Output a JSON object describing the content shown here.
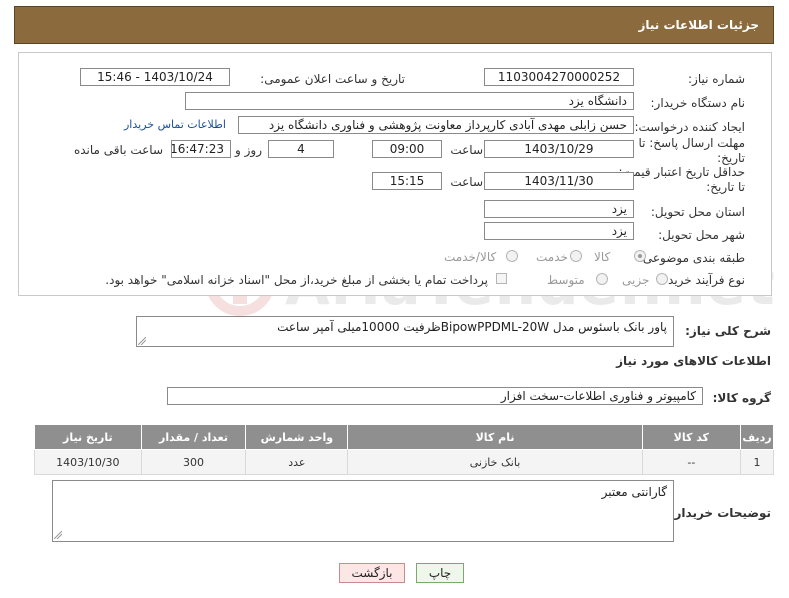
{
  "header": {
    "title": "جزئیات اطلاعات نیاز"
  },
  "form": {
    "need_number_label": "شماره نیاز:",
    "need_number": "1103004270000252",
    "announce_label": "تاریخ و ساعت اعلان عمومی:",
    "announce_value": "1403/10/24 - 15:46",
    "buyer_label": "نام دستگاه خریدار:",
    "buyer_value": "دانشگاه یزد",
    "creator_label": "ایجاد کننده درخواست:",
    "creator_value": "حسن زابلی مهدی آبادی کارپرداز معاونت پژوهشی و فناوری دانشگاه یزد",
    "contact_link": "اطلاعات تماس خریدار",
    "reply_label": "مهلت ارسال پاسخ: تا تاریخ:",
    "reply_date": "1403/10/29",
    "time_label": "ساعت",
    "reply_time": "09:00",
    "days_value": "4",
    "days_label": "روز و",
    "remaining_value": "16:47:23",
    "remaining_label": "ساعت باقی مانده",
    "validity_label": "حداقل تاریخ اعتبار قیمت: تا تاریخ:",
    "validity_date": "1403/11/30",
    "validity_time": "15:15",
    "province_label": "استان محل تحویل:",
    "province_value": "یزد",
    "city_label": "شهر محل تحویل:",
    "city_value": "یزد",
    "category_label": "طبقه بندی موضوعی:",
    "category_options": [
      "کالا",
      "خدمت",
      "کالا/خدمت"
    ],
    "category_selected": "کالا",
    "process_label": "نوع فرآیند خرید :",
    "process_options": [
      "جزیی",
      "متوسط"
    ],
    "payment_note": "پرداخت تمام یا بخشی از مبلغ خرید،از محل \"اسناد خزانه اسلامی\" خواهد بود."
  },
  "summary": {
    "label": "شرح کلی نیاز:",
    "value": "پاور بانک باسئوس مدل BipowPPDML-20Wظرفیت 10000میلی آمپر ساعت"
  },
  "goods": {
    "section_title": "اطلاعات کالاهای مورد نیاز",
    "group_label": "گروه کالا:",
    "group_value": "کامپیوتر و فناوری اطلاعات-سخت افزار",
    "columns": [
      "ردیف",
      "کد کالا",
      "نام کالا",
      "واحد شمارش",
      "تعداد / مقدار",
      "تاریخ نیاز"
    ],
    "rows": [
      [
        "1",
        "--",
        "بانک خازنی",
        "عدد",
        "300",
        "1403/10/30"
      ]
    ]
  },
  "buyer_notes": {
    "label": "توضیحات خریدار:",
    "value": "گارانتی معتبر"
  },
  "buttons": {
    "print": "چاپ",
    "back": "بازگشت"
  },
  "watermark": "AriaTender.net",
  "colors": {
    "header": "#8b6b3d",
    "table_header": "#8f8f8f",
    "link": "#1a4f9c"
  }
}
